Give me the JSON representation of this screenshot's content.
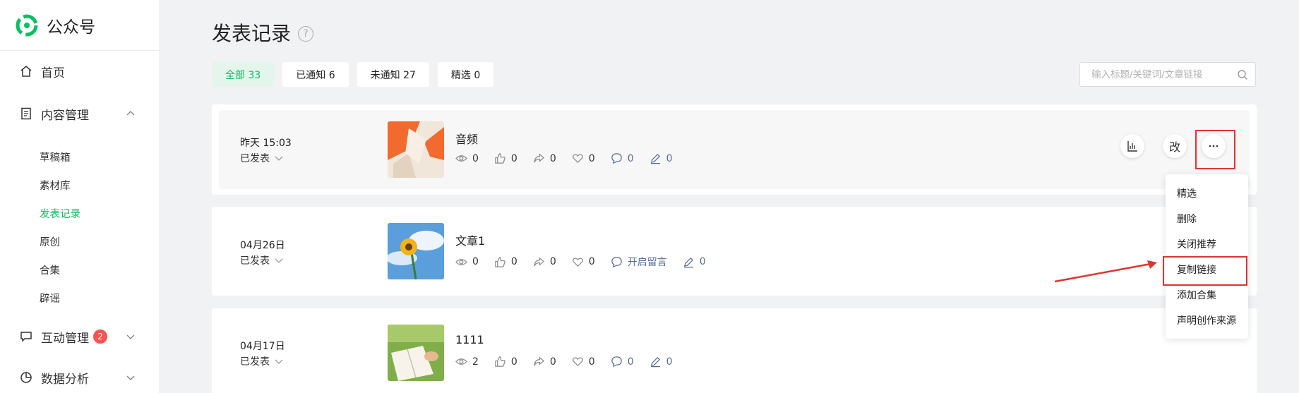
{
  "brand": {
    "name": "公众号"
  },
  "sidebar": {
    "home": "首页",
    "content": {
      "label": "内容管理",
      "items": [
        "草稿箱",
        "素材库",
        "发表记录",
        "原创",
        "合集",
        "辟谣"
      ]
    },
    "interaction": {
      "label": "互动管理",
      "badge": "2"
    },
    "analytics": {
      "label": "数据分析"
    }
  },
  "page": {
    "title": "发表记录",
    "help": "?",
    "filters": [
      {
        "label": "全部 33",
        "active": true
      },
      {
        "label": "已通知 6"
      },
      {
        "label": "未通知 27"
      },
      {
        "label": "精选 0"
      }
    ],
    "search_placeholder": "输入标题/关键词/文章链接"
  },
  "articles": [
    {
      "date": "昨天 15:03",
      "status": "已发表",
      "title": "音频",
      "reads": "0",
      "likes": "0",
      "shares": "0",
      "favorites": "0",
      "comments": "0",
      "edits": "0"
    },
    {
      "date": "04月26日",
      "status": "已发表",
      "title": "文章1",
      "reads": "0",
      "likes": "0",
      "shares": "0",
      "favorites": "0",
      "comments": "开启留言",
      "edits": "0"
    },
    {
      "date": "04月17日",
      "status": "已发表",
      "title": "1111",
      "reads": "2",
      "likes": "0",
      "shares": "0",
      "favorites": "0",
      "comments": "0",
      "edits": "0"
    }
  ],
  "actions": {
    "edit_label": "改"
  },
  "menu": {
    "items": [
      "精选",
      "删除",
      "关闭推荐",
      "复制链接",
      "添加合集",
      "声明创作来源"
    ]
  },
  "colors": {
    "accent": "#07c160",
    "link": "#576b95",
    "badge": "#fa5151",
    "annotation": "#e0332f"
  }
}
